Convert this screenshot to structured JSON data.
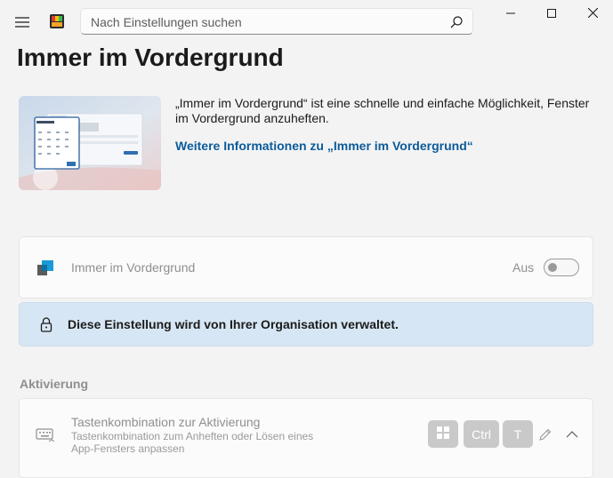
{
  "titlebar": {
    "search_placeholder": "Nach Einstellungen suchen",
    "icons": {
      "menu": "hamburger-icon",
      "app": "app-logo-icon",
      "search": "search-icon",
      "minimize": "minimize-icon",
      "maximize": "maximize-icon",
      "close": "close-icon"
    }
  },
  "page": {
    "title": "Immer im Vordergrund",
    "description": "„Immer im Vordergrund“ ist eine schnelle und einfache Möglichkeit, Fenster im Vordergrund anzuheften.",
    "learn_more": "Weitere Informationen zu „Immer im Vordergrund“"
  },
  "feature_toggle": {
    "label": "Immer im Vordergrund",
    "state": "Aus",
    "enabled": false,
    "icon": "always-on-top-icon"
  },
  "policy_info": {
    "text": "Diese Einstellung wird von Ihrer Organisation verwaltet.",
    "icon": "lock-icon"
  },
  "activation": {
    "section_label": "Aktivierung",
    "shortcut_title": "Tastenkombination zur Aktivierung",
    "shortcut_description": "Tastenkombination zum Anheften oder Lösen eines App-Fensters anpassen",
    "keys": {
      "win": "windows-key-icon",
      "ctrl": "Ctrl",
      "t": "T"
    },
    "icons": {
      "keyboard": "keyboard-icon",
      "edit": "pencil-icon",
      "collapse": "chevron-up-icon"
    }
  },
  "colors": {
    "accent_link": "#0b5b9a",
    "info_bg": "#d7e6f4",
    "background": "#f3f3f3"
  }
}
